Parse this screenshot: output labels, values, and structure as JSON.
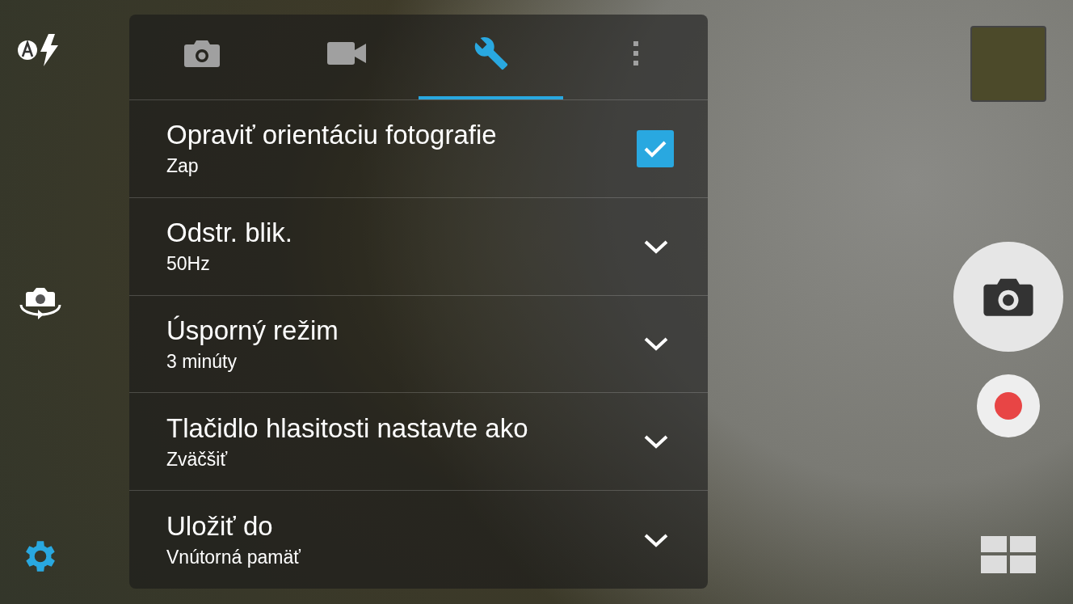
{
  "tabs": [
    {
      "kind": "camera",
      "selected": false
    },
    {
      "kind": "video",
      "selected": false
    },
    {
      "kind": "tools",
      "selected": true
    },
    {
      "kind": "more",
      "selected": false
    }
  ],
  "settings": [
    {
      "title": "Opraviť orientáciu fotografie",
      "value": "Zap",
      "kind": "checkbox",
      "checked": true
    },
    {
      "title": "Odstr. blik.",
      "value": "50Hz",
      "kind": "dropdown"
    },
    {
      "title": "Úsporný režim",
      "value": "3 minúty",
      "kind": "dropdown"
    },
    {
      "title": "Tlačidlo hlasitosti nastavte ako",
      "value": "Zväčšiť",
      "kind": "dropdown"
    },
    {
      "title": "Uložiť do",
      "value": "Vnútorná pamäť",
      "kind": "dropdown"
    }
  ]
}
